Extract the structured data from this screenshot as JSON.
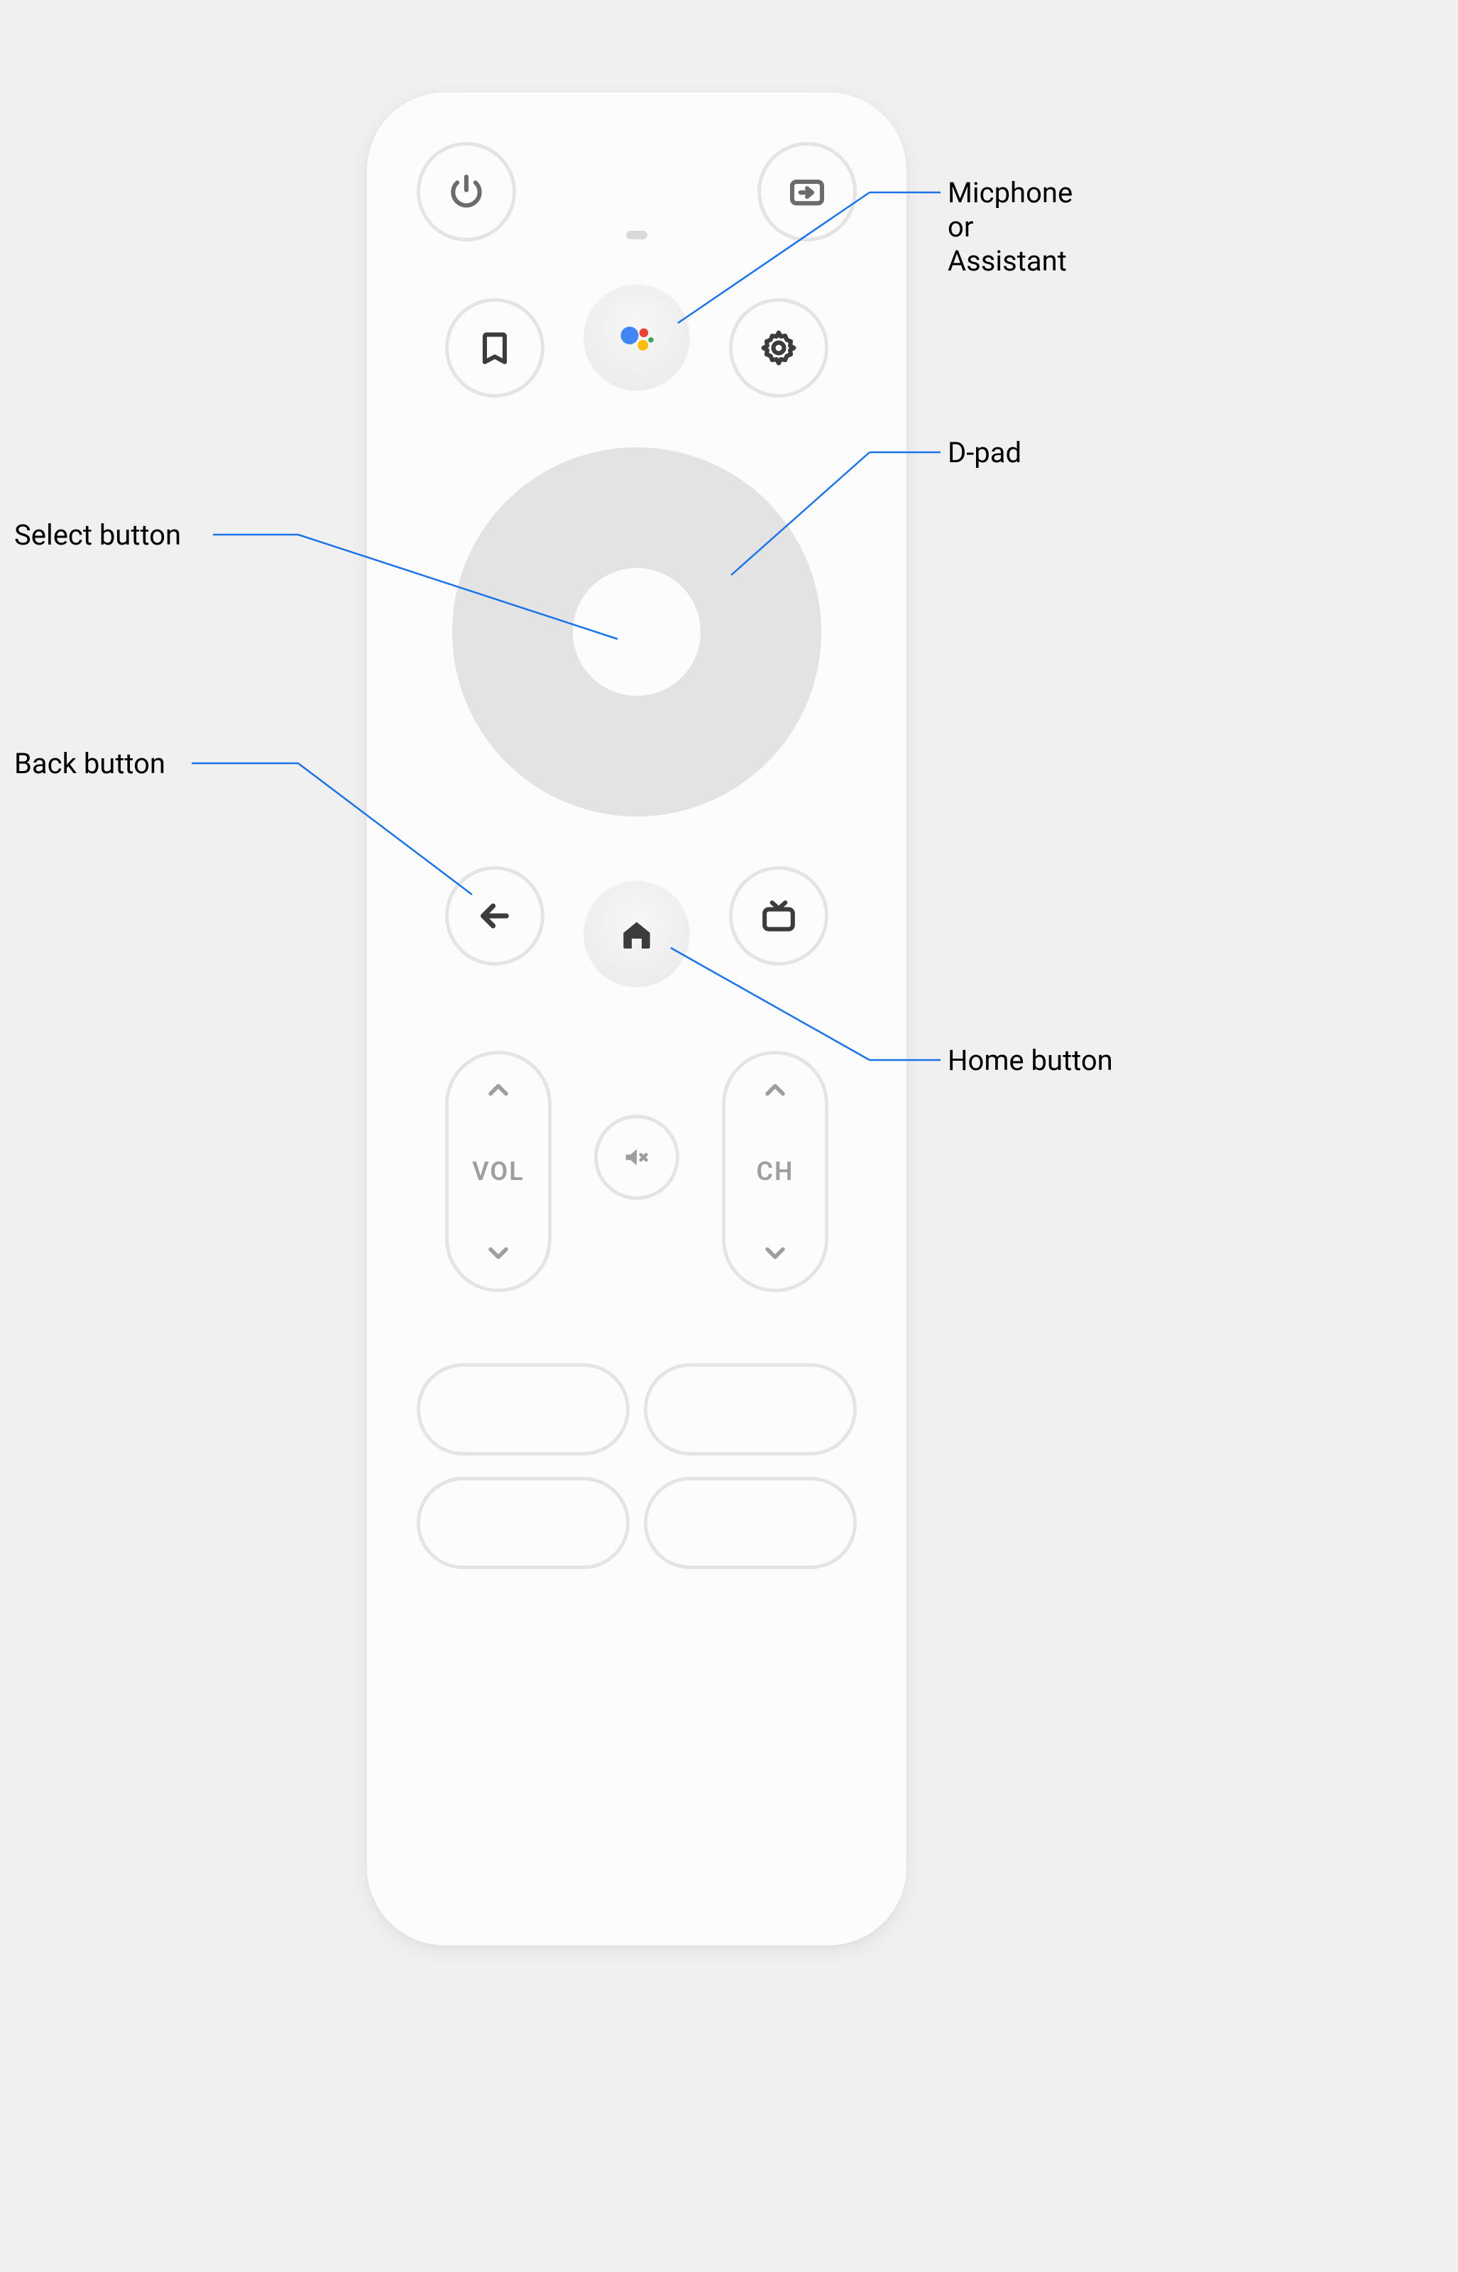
{
  "annotations": {
    "assistant": "Micphone\nor\nAssistant",
    "dpad": "D-pad",
    "select": "Select button",
    "back": "Back button",
    "home": "Home button"
  },
  "rocker": {
    "volume_label": "VOL",
    "channel_label": "CH"
  },
  "icons": {
    "power": "power-icon",
    "input": "input-icon",
    "bookmark": "bookmark-icon",
    "assistant": "assistant-icon",
    "settings": "gear-icon",
    "back": "arrow-left-icon",
    "home": "home-icon",
    "tv": "tv-icon",
    "mute": "mute-icon",
    "up": "chevron-up-icon",
    "down": "chevron-down-icon"
  },
  "colors": {
    "assistant_blue": "#4285F4",
    "assistant_red": "#EA4335",
    "assistant_yellow": "#FBBC05",
    "assistant_green": "#34A853",
    "annotation_line": "#1a73e8"
  }
}
